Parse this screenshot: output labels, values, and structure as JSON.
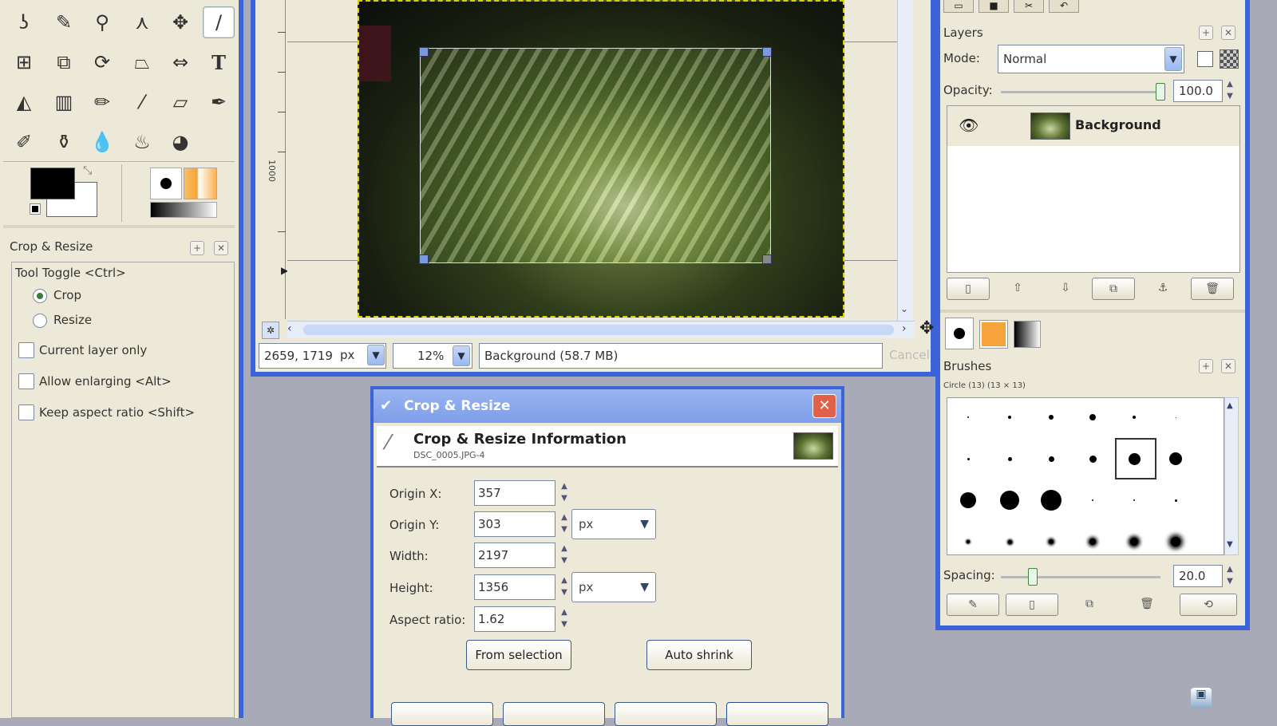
{
  "toolbox": {
    "tools": [
      "free-select",
      "color-picker",
      "zoom",
      "measure",
      "move",
      "brush-active",
      "align",
      "crop",
      "rotate",
      "perspective",
      "flip",
      "text",
      "bucket-fill",
      "blend",
      "pencil",
      "airbrush",
      "eraser",
      "ink",
      "clone",
      "heal",
      "smudge",
      "dodge-burn",
      "convolve"
    ],
    "text_tool_label": "T",
    "options_title": "Crop & Resize",
    "tool_toggle": "Tool Toggle  <Ctrl>",
    "crop": "Crop",
    "resize": "Resize",
    "current_layer_only": "Current layer only",
    "allow_enlarging": "Allow enlarging  <Alt>",
    "keep_aspect": "Keep aspect ratio  <Shift>"
  },
  "image_window": {
    "coords": "2659, 1719",
    "unit": "px",
    "zoom": "12%",
    "status": "Background (58.7 MB)",
    "cancel": "Cancel",
    "ruler_label": "1000"
  },
  "dialog": {
    "title": "Crop & Resize",
    "info_title": "Crop & Resize Information",
    "info_subtitle": "DSC_0005.JPG-4",
    "origin_x_label": "Origin X:",
    "origin_x": "357",
    "origin_y_label": "Origin Y:",
    "origin_y": "303",
    "width_label": "Width:",
    "width": "2197",
    "height_label": "Height:",
    "height": "1356",
    "aspect_label": "Aspect ratio:",
    "aspect": "1.62",
    "unit1": "px",
    "unit2": "px",
    "from_selection": "From selection",
    "auto_shrink": "Auto shrink",
    "close_glyph": "✕"
  },
  "layers": {
    "title": "Layers",
    "mode_label": "Mode:",
    "mode": "Normal",
    "opacity_label": "Opacity:",
    "opacity": "100.0",
    "opacity_fraction": 1.0,
    "layer_name": "Background"
  },
  "brushes": {
    "title": "Brushes",
    "subtitle": "Circle (13) (13 × 13)",
    "spacing_label": "Spacing:",
    "spacing": "20.0",
    "spacing_fraction": 0.2
  },
  "colors": {
    "accent": "#3c63d8",
    "chrome": "#ece9d8",
    "desktop": "#a8aab8"
  }
}
